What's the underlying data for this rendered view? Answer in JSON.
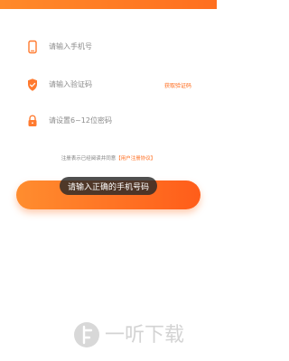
{
  "phone_field": {
    "placeholder": "请输入手机号",
    "icon": "phone-icon"
  },
  "code_field": {
    "placeholder": "请输入验证码",
    "icon": "shield-icon",
    "get_code_label": "获取验证码"
  },
  "password_field": {
    "placeholder": "请设置6~12位密码",
    "icon": "lock-icon"
  },
  "agreement": {
    "prefix": "注册表示已经阅读并同意",
    "link_text": "【用户注册协议】"
  },
  "toast": {
    "text": "请输入正确的手机号码"
  },
  "submit_button": {
    "label": ""
  },
  "watermark": {
    "text": "一听下载"
  },
  "colors": {
    "accent": "#ff6a1a",
    "icon": "#ff7a2f"
  }
}
